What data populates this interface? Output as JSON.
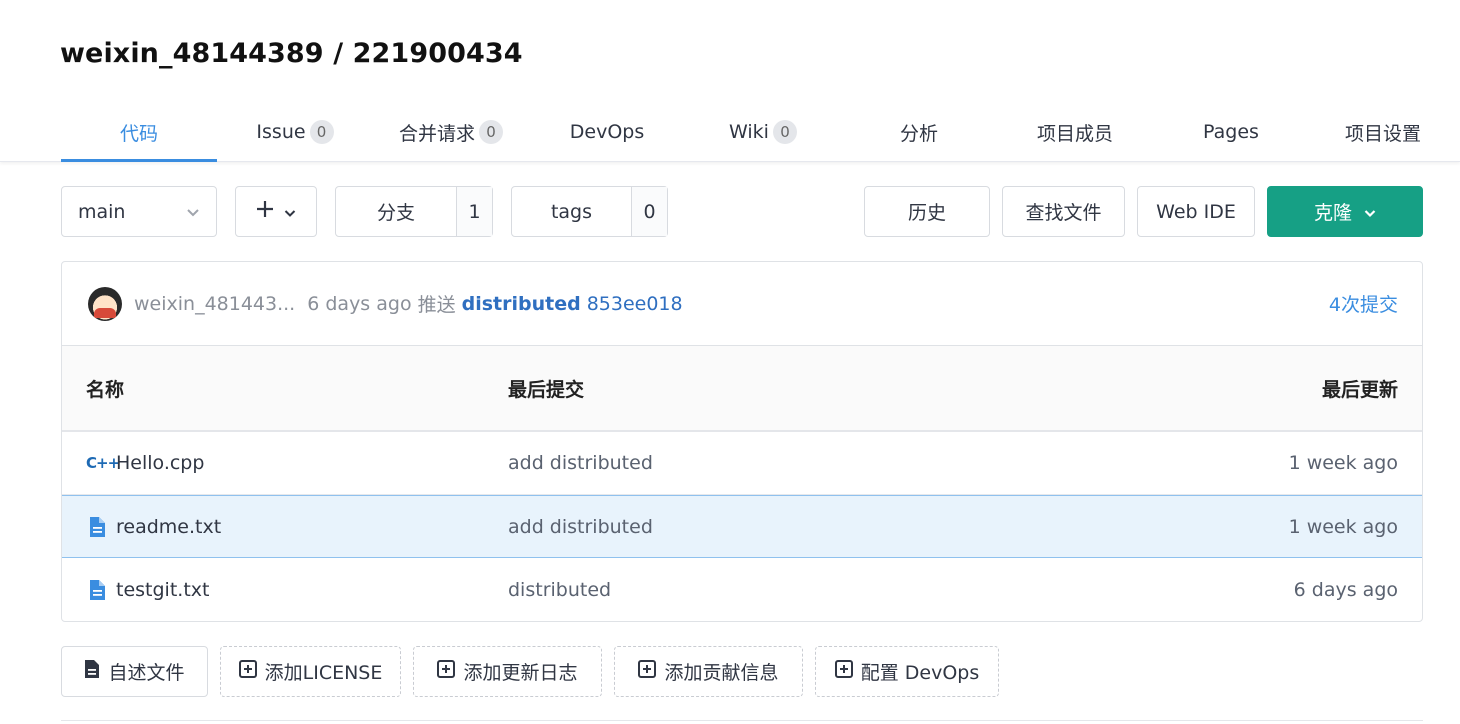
{
  "repo": {
    "title": "weixin_48144389 / 221900434"
  },
  "tabs": [
    {
      "label": "代码",
      "badge": null
    },
    {
      "label": "Issue",
      "badge": "0"
    },
    {
      "label": "合并请求",
      "badge": "0"
    },
    {
      "label": "DevOps",
      "badge": null
    },
    {
      "label": "Wiki",
      "badge": "0"
    },
    {
      "label": "分析",
      "badge": null
    },
    {
      "label": "项目成员",
      "badge": null
    },
    {
      "label": "Pages",
      "badge": null
    },
    {
      "label": "项目设置",
      "badge": null
    }
  ],
  "toolbar": {
    "branch_select": "main",
    "branches_label": "分支",
    "branches_count": "1",
    "tags_label": "tags",
    "tags_count": "0",
    "history": "历史",
    "find_file": "查找文件",
    "web_ide": "Web IDE",
    "clone": "克隆"
  },
  "latest_commit": {
    "author": "weixin_481443...",
    "time": "6 days ago",
    "action": "推送",
    "message": "distributed",
    "hash": "853ee018",
    "count": "4次提交"
  },
  "table": {
    "headers": {
      "name": "名称",
      "last_commit": "最后提交",
      "last_update": "最后更新"
    },
    "rows": [
      {
        "icon": "cpp-file-icon",
        "name": "Hello.cpp",
        "commit": "add distributed",
        "updated": "1 week ago"
      },
      {
        "icon": "text-file-icon",
        "name": "readme.txt",
        "commit": "add distributed",
        "updated": "1 week ago"
      },
      {
        "icon": "text-file-icon",
        "name": "testgit.txt",
        "commit": "distributed",
        "updated": "6 days ago"
      }
    ]
  },
  "actions": {
    "readme": "自述文件",
    "license": "添加LICENSE",
    "changelog": "添加更新日志",
    "contrib": "添加贡献信息",
    "devops": "配置 DevOps"
  },
  "colors": {
    "accent": "#3a8de0",
    "clone_button": "#16a085",
    "selected_row": "#e8f3fc"
  }
}
